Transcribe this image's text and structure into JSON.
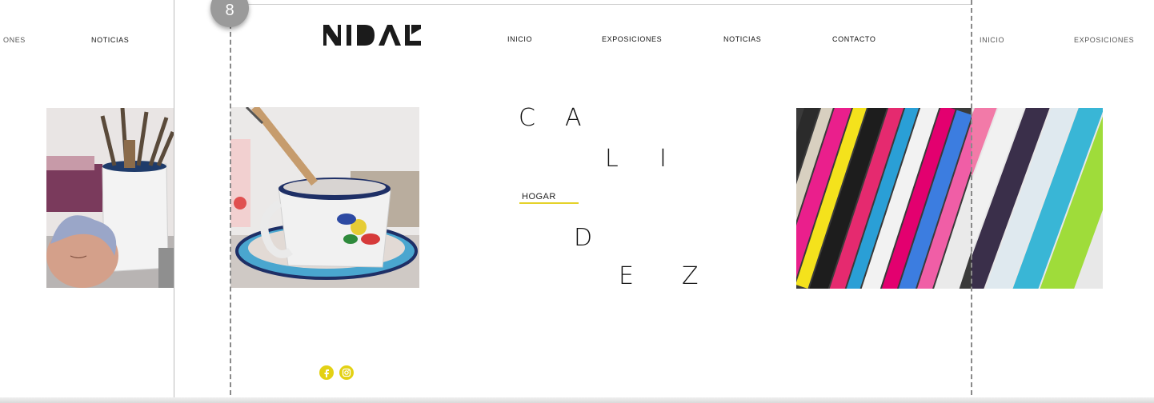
{
  "left_panel": {
    "nav_partial": "ONES",
    "nav_noticias": "NOTICIAS"
  },
  "page_badge": "8",
  "main": {
    "logo": "NIDAL",
    "nav": [
      "INICIO",
      "EXPOSICIONES",
      "NOTICIAS",
      "CONTACTO"
    ],
    "title_letters": [
      "C",
      "A",
      "L",
      "I",
      "D",
      "E",
      "Z"
    ],
    "category_link": "HOGAR",
    "accent_color": "#e3d114"
  },
  "right_panel": {
    "nav": [
      "INICIO",
      "EXPOSICIONES"
    ]
  },
  "icons": [
    "facebook-icon",
    "instagram-icon"
  ]
}
